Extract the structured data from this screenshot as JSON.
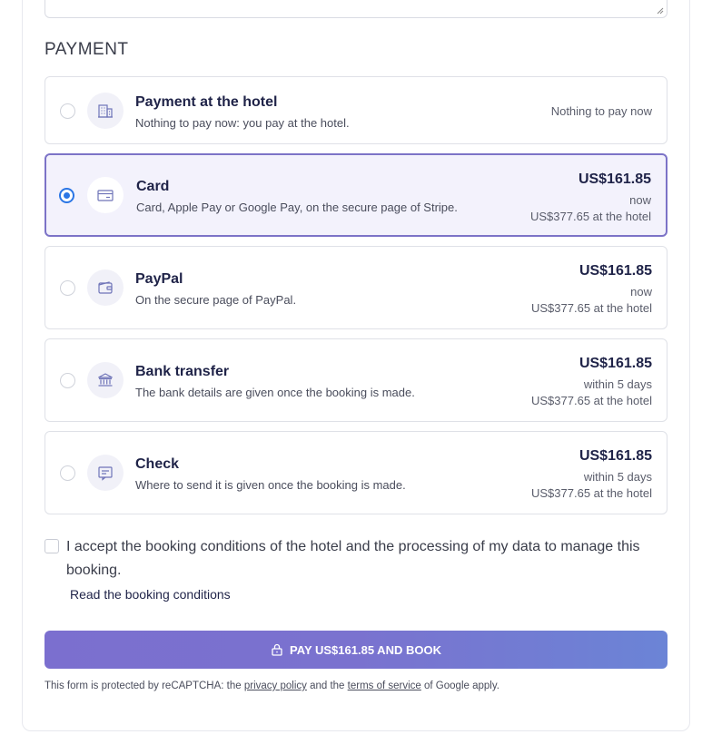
{
  "section_title": "PAYMENT",
  "options": [
    {
      "title": "Payment at the hotel",
      "description": "Nothing to pay now: you pay at the hotel.",
      "right_note": "Nothing to pay now",
      "icon": "hotel-building-icon",
      "selected": false
    },
    {
      "title": "Card",
      "description": "Card, Apple Pay or Google Pay, on the secure page of Stripe.",
      "amount": "US$161.85",
      "amount_note": "now",
      "at_hotel": "US$377.65 at the hotel",
      "icon": "credit-card-icon",
      "selected": true
    },
    {
      "title": "PayPal",
      "description": "On the secure page of PayPal.",
      "amount": "US$161.85",
      "amount_note": "now",
      "at_hotel": "US$377.65 at the hotel",
      "icon": "wallet-icon",
      "selected": false
    },
    {
      "title": "Bank transfer",
      "description": "The bank details are given once the booking is made.",
      "amount": "US$161.85",
      "amount_note": "within 5 days",
      "at_hotel": "US$377.65 at the hotel",
      "icon": "bank-icon",
      "selected": false
    },
    {
      "title": "Check",
      "description": "Where to send it is given once the booking is made.",
      "amount": "US$161.85",
      "amount_note": "within 5 days",
      "at_hotel": "US$377.65 at the hotel",
      "icon": "check-document-icon",
      "selected": false
    }
  ],
  "accept": {
    "text": "I accept the booking conditions of the hotel and the processing of my data to manage this booking.",
    "checked": false,
    "link": "Read the booking conditions"
  },
  "pay_button": {
    "label": "PAY US$161.85 AND BOOK",
    "icon": "lock-icon"
  },
  "recaptcha": {
    "before": "This form is protected by reCAPTCHA: the ",
    "privacy": "privacy policy",
    "middle": " and the ",
    "terms": "terms of service",
    "after": " of Google apply."
  },
  "colors": {
    "accent": "#7c73c7",
    "radio_selected": "#2b76e5",
    "selected_bg": "#f3f2fc",
    "text_dark": "#1f2348"
  }
}
